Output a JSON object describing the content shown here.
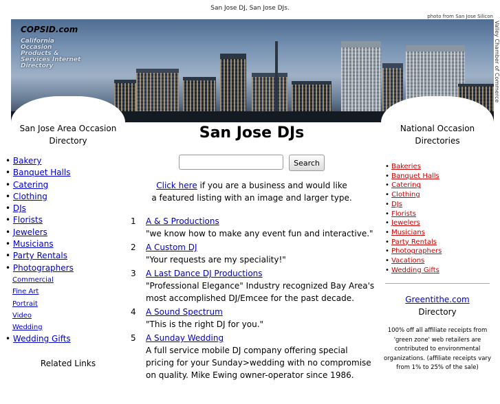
{
  "page": {
    "top_title": "San Jose DJ, San Jose DJs.",
    "photo_credit": "photo from San Jose Silicon",
    "photo_credit_vertical": "Valley Chamber of Commerce"
  },
  "brand": {
    "name": "COPSID.com",
    "tagline": "California Occasion Products & Services Internet Directory"
  },
  "left": {
    "heading": "San Jose Area Occasion Directory",
    "items": [
      {
        "label": "Bakery",
        "sub": false
      },
      {
        "label": "Banquet Halls",
        "sub": false
      },
      {
        "label": "Catering",
        "sub": false
      },
      {
        "label": "Clothing",
        "sub": false
      },
      {
        "label": "DJs",
        "sub": false
      },
      {
        "label": "Florists",
        "sub": false
      },
      {
        "label": "Jewelers",
        "sub": false
      },
      {
        "label": "Musicians",
        "sub": false
      },
      {
        "label": "Party Rentals",
        "sub": false
      },
      {
        "label": "Photographers",
        "sub": false
      },
      {
        "label": "Commercial",
        "sub": true
      },
      {
        "label": "Fine Art",
        "sub": true
      },
      {
        "label": "Portrait",
        "sub": true
      },
      {
        "label": "Video",
        "sub": true
      },
      {
        "label": "Wedding",
        "sub": true
      },
      {
        "label": "Wedding Gifts",
        "sub": false
      }
    ],
    "related_links": "Related Links"
  },
  "main": {
    "title": "San Jose DJs",
    "search": {
      "value": "",
      "placeholder": "",
      "button": "Search"
    },
    "promo_link": "Click here",
    "promo_text_1": " if you are a business and would like",
    "promo_text_2": "a featured listing with an image and larger type.",
    "listings": [
      {
        "num": "1",
        "name": "A & S Productions",
        "desc": "\"we know how to make any event fun and interactive.\""
      },
      {
        "num": "2",
        "name": "A Custom DJ",
        "desc": "\"Your requests are my speciality!\""
      },
      {
        "num": "3",
        "name": "A Last Dance DJ Productions",
        "desc": "\"Professional Elegance\" Industry recognized Bay Area's most accomplished DJ/Emcee for the past decade."
      },
      {
        "num": "4",
        "name": "A Sound Spectrum",
        "desc": "\"This is the right DJ for you.\""
      },
      {
        "num": "5",
        "name": "A Sunday Wedding",
        "desc": "A full service mobile DJ company offering special pricing for your Sunday>wedding with no compromise on quality. Mike Ewing owner-operator since 1986."
      }
    ]
  },
  "right": {
    "heading": "National Occasion Directories",
    "items": [
      "Bakeries",
      "Banquet Halls",
      "Catering",
      "Clothing",
      "DJs",
      "Florists",
      "Jewelers",
      "Musicians",
      "Party Rentals",
      "Photographers",
      "Vacations",
      "Wedding Gifts"
    ],
    "greentithe_link": "Greentithe.com",
    "greentithe_label": "Directory",
    "affiliate_text": "100% off all affiliate receipts from 'green zone' web retailers are contributed to environmental organizations. (affiliate receipts vary from 1% to 25% of the sale)"
  },
  "colors": {
    "link": "#0000cc",
    "national_link": "#cc0000",
    "sky": "#7893b3"
  }
}
